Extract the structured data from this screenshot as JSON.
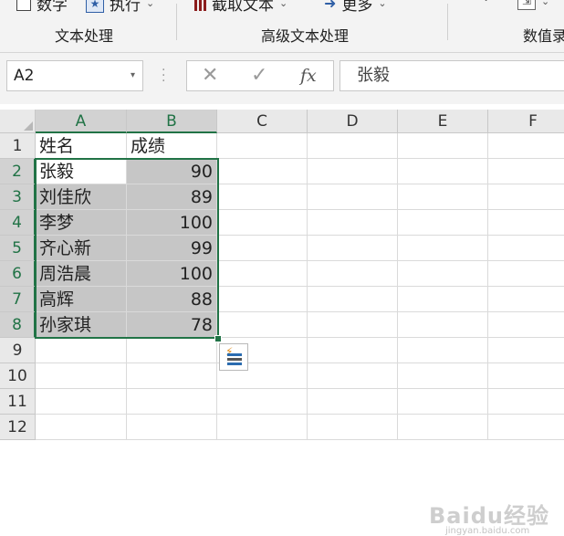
{
  "ribbon": {
    "items": [
      {
        "label": "数字"
      },
      {
        "label": "执行"
      },
      {
        "label": "截取文本"
      },
      {
        "label": "更多"
      }
    ],
    "groups": [
      {
        "label": "文本处理"
      },
      {
        "label": "高级文本处理"
      },
      {
        "label": "数值录"
      }
    ]
  },
  "formula_bar": {
    "name_box": "A2",
    "fx_label": "fx",
    "content": "张毅"
  },
  "sheet": {
    "columns": [
      "A",
      "B",
      "C",
      "D",
      "E",
      "F"
    ],
    "rows": [
      "1",
      "2",
      "3",
      "4",
      "5",
      "6",
      "7",
      "8",
      "9",
      "10",
      "11",
      "12"
    ],
    "header": {
      "name": "姓名",
      "score": "成绩"
    },
    "records": [
      {
        "name": "张毅",
        "score": "90"
      },
      {
        "name": "刘佳欣",
        "score": "89"
      },
      {
        "name": "李梦",
        "score": "100"
      },
      {
        "name": "齐心新",
        "score": "99"
      },
      {
        "name": "周浩晨",
        "score": "100"
      },
      {
        "name": "高辉",
        "score": "88"
      },
      {
        "name": "孙家琪",
        "score": "78"
      }
    ],
    "active_cell": "A2",
    "selection": "A2:B8"
  },
  "watermark": {
    "main": "Baidu经验",
    "sub": "jingyan.baidu.com"
  },
  "colors": {
    "accent": "#217346",
    "selection_fill": "#c6c6c6"
  }
}
